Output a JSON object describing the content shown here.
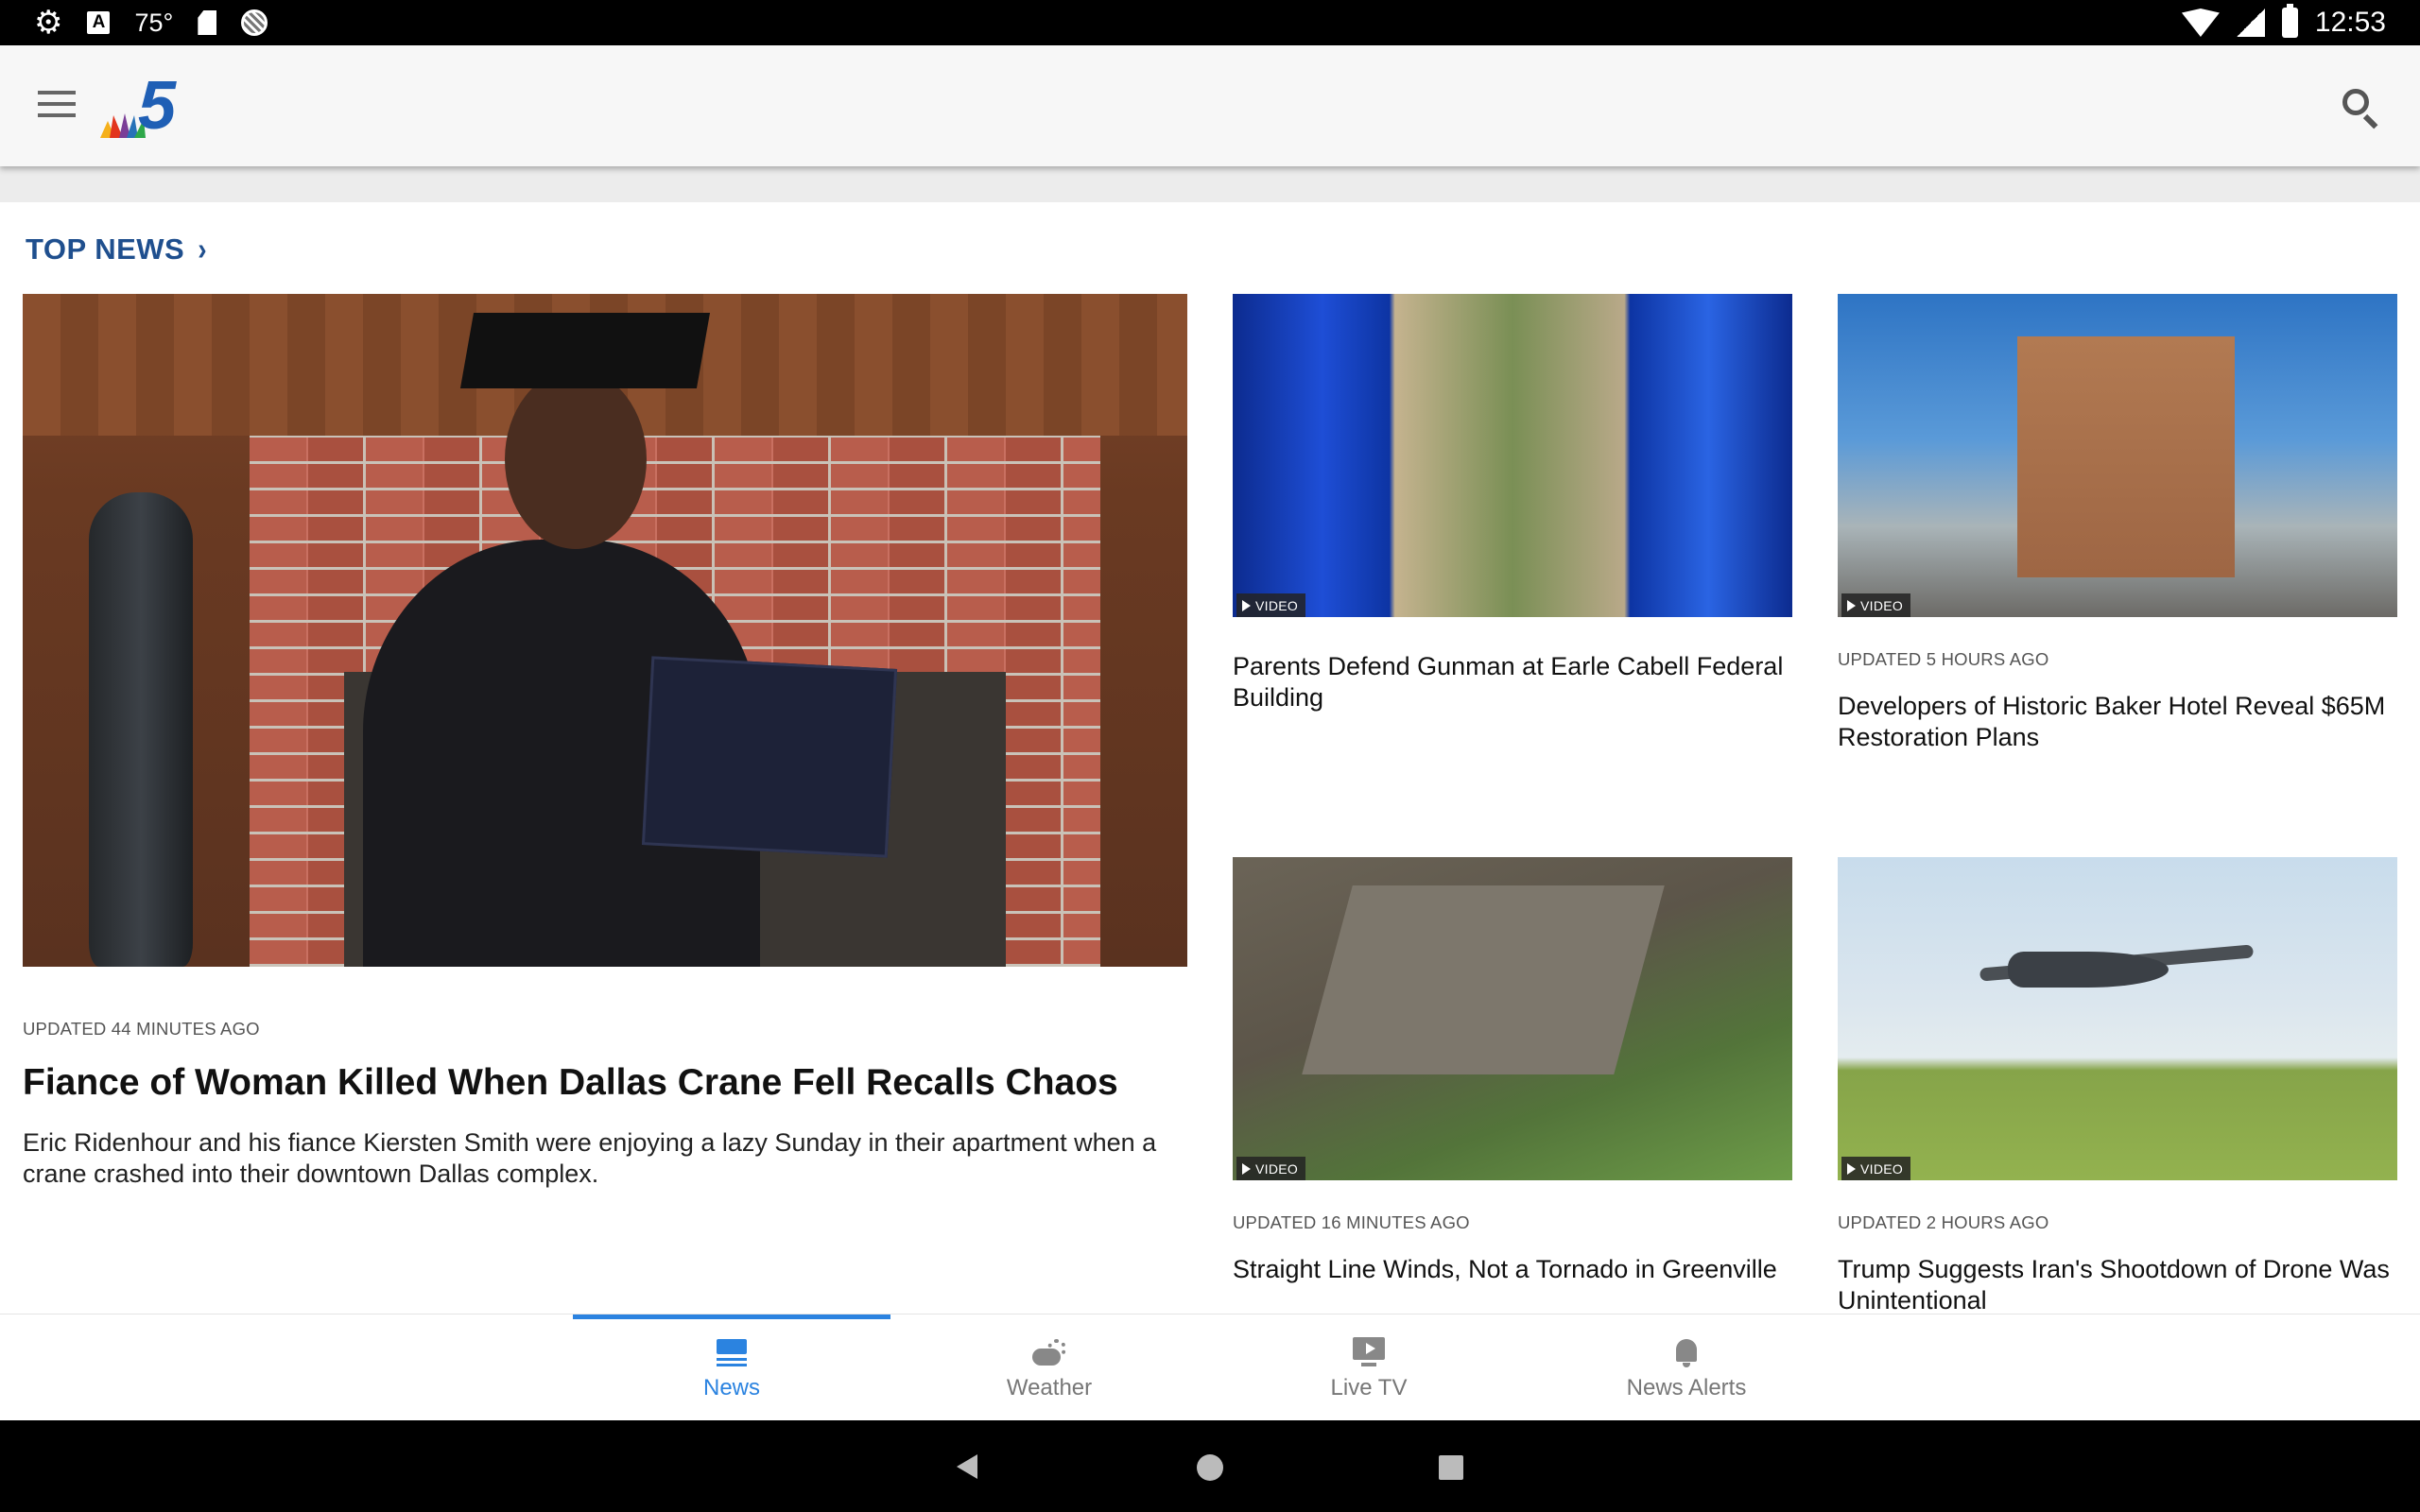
{
  "status_bar": {
    "temperature": "75°",
    "a_label": "A",
    "time": "12:53",
    "icons": [
      "gear-icon",
      "a-badge-icon",
      "sd-card-icon",
      "circle-icon",
      "wifi-icon",
      "signal-icon",
      "battery-icon"
    ]
  },
  "app_bar": {
    "logo_text": "5",
    "icons": [
      "menu-icon",
      "nbc-logo-icon",
      "search-icon"
    ]
  },
  "section": {
    "title": "TOP NEWS",
    "chevron": "›"
  },
  "stories": {
    "lead": {
      "meta": "UPDATED 44 MINUTES AGO",
      "headline": "Fiance of Woman Killed When Dallas Crane Fell Recalls Chaos",
      "summary": "Eric Ridenhour and his fiance Kiersten Smith were enjoying a lazy Sunday in their apartment when a crane crashed into their downtown Dallas complex."
    },
    "s2": {
      "badge": "VIDEO",
      "headline": "Parents Defend Gunman at Earle Cabell Federal Building"
    },
    "s3": {
      "badge": "VIDEO",
      "meta": "UPDATED 5 HOURS AGO",
      "headline": "Developers of Historic Baker Hotel Reveal $65M Restoration Plans"
    },
    "s4": {
      "badge": "VIDEO",
      "meta": "UPDATED 16 MINUTES AGO",
      "headline": "Straight Line Winds, Not a Tornado in Greenville"
    },
    "s5": {
      "badge": "VIDEO",
      "meta": "UPDATED 2 HOURS AGO",
      "headline": "Trump Suggests Iran's Shootdown of Drone Was Unintentional"
    }
  },
  "bottom_nav": {
    "items": [
      {
        "label": "News",
        "icon": "news-icon",
        "active": true
      },
      {
        "label": "Weather",
        "icon": "weather-icon",
        "active": false
      },
      {
        "label": "Live TV",
        "icon": "live-tv-icon",
        "active": false
      },
      {
        "label": "News Alerts",
        "icon": "bell-icon",
        "active": false
      }
    ]
  },
  "colors": {
    "accent": "#2b83e0",
    "section_title": "#1f4f8e",
    "app_bar_bg": "#f7f7f7"
  }
}
